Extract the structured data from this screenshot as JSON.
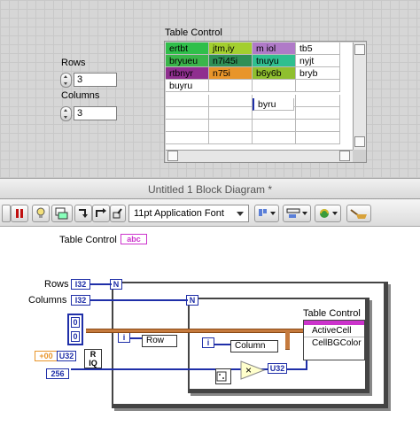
{
  "front_panel": {
    "table_label": "Table Control",
    "rows_label": "Rows",
    "rows_value": "3",
    "columns_label": "Columns",
    "columns_value": "3",
    "table": [
      [
        {
          "text": "ertbt",
          "bg": "#2fbf4a"
        },
        {
          "text": "jtm,iy",
          "bg": "#a3cf2f"
        },
        {
          "text": "m iol",
          "bg": "#b07ac8"
        },
        {
          "text": "tb5",
          "bg": "#ffffff"
        }
      ],
      [
        {
          "text": "bryueu",
          "bg": "#3ab54a"
        },
        {
          "text": "n7i45i",
          "bg": "#2f8f56"
        },
        {
          "text": "tnuyu",
          "bg": "#2fbf8f"
        },
        {
          "text": "nyjt",
          "bg": "#ffffff"
        }
      ],
      [
        {
          "text": "rtbnyr",
          "bg": "#8f2f8f"
        },
        {
          "text": "n75i",
          "bg": "#e8952a"
        },
        {
          "text": "b6y6b",
          "bg": "#8fbf2f"
        },
        {
          "text": "bryb",
          "bg": "#ffffff"
        }
      ],
      [
        {
          "text": "buyru",
          "bg": "#ffffff"
        },
        {
          "text": "",
          "bg": "#ffffff"
        },
        {
          "text": "",
          "bg": "#ffffff"
        },
        {
          "text": "",
          "bg": "#ffffff"
        }
      ]
    ],
    "floating_text": "byru"
  },
  "window": {
    "title": "Untitled 1 Block Diagram *"
  },
  "toolbar": {
    "font": "11pt Application Font"
  },
  "diagram": {
    "table_control_label": "Table Control",
    "table_terminal": "abc",
    "rows_label": "Rows",
    "columns_label": "Columns",
    "i32": "I32",
    "u32": "U32",
    "n": "N",
    "i": "i",
    "row_label": "Row",
    "column_label": "Column",
    "const_0a": "0",
    "const_0b": "0",
    "const_256": "256",
    "const_plus00": "+00",
    "random_r": "R",
    "random_iq": "IQ",
    "multiply": "×",
    "node_title": "Table Control",
    "node_prop1": "ActiveCell",
    "node_prop2": "CellBGColor"
  }
}
